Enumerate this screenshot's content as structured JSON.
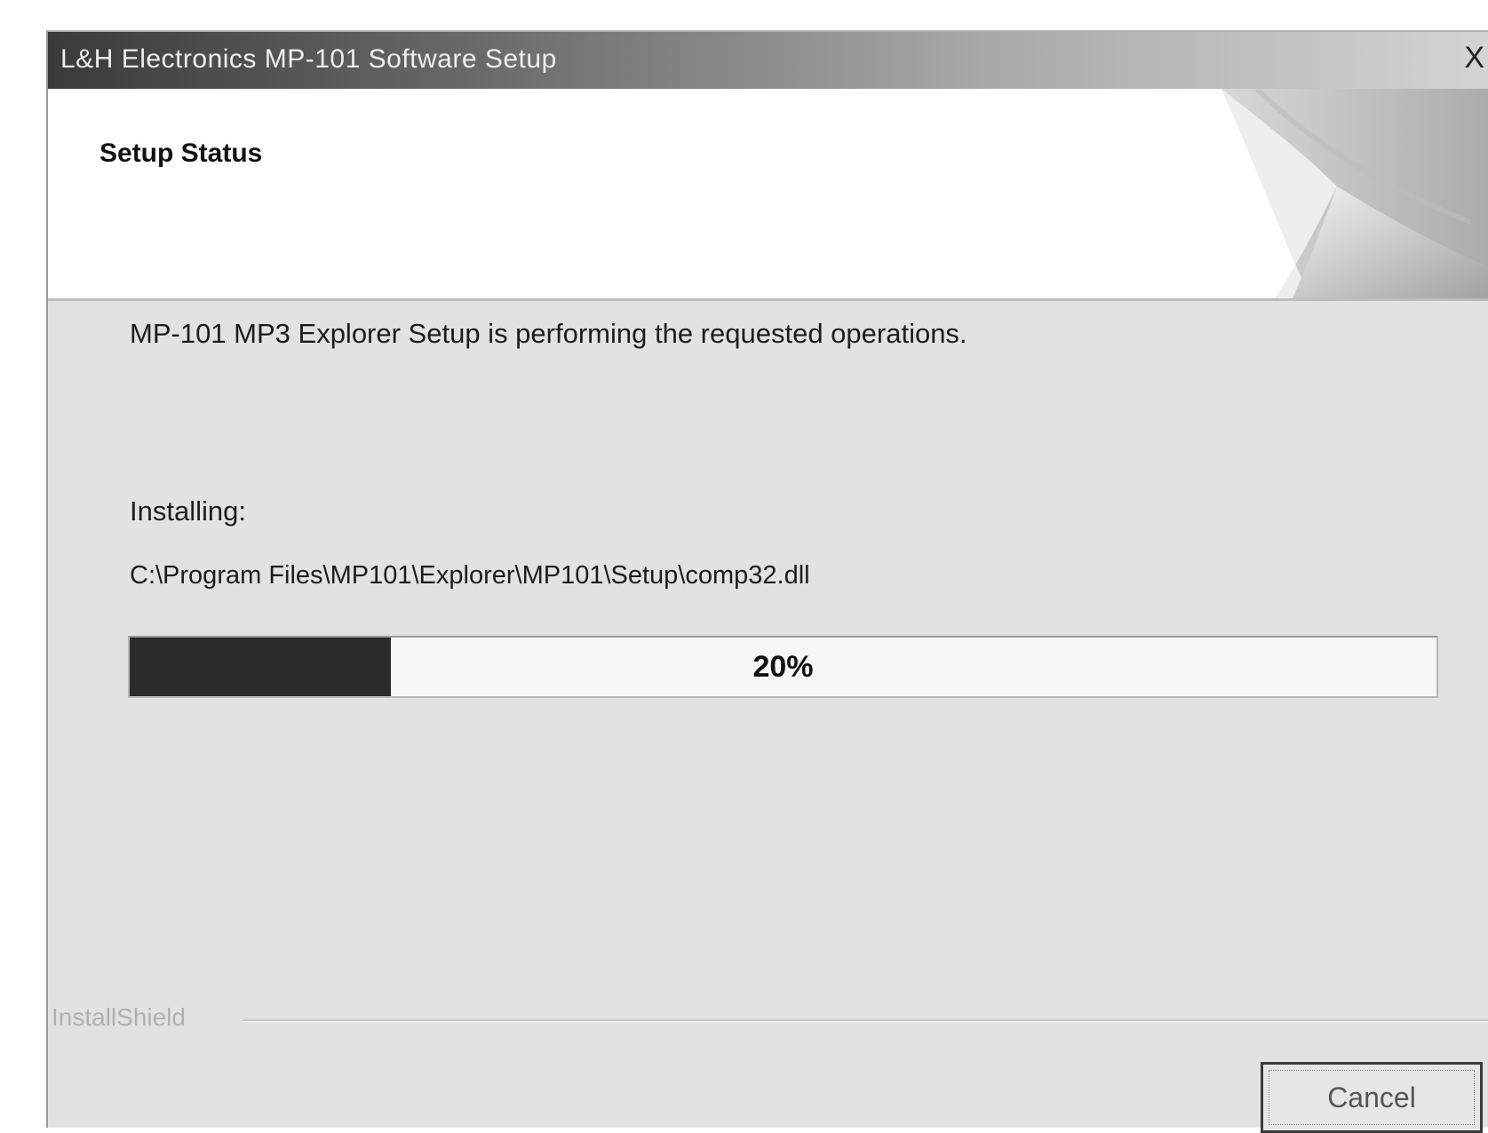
{
  "window": {
    "title": "L&H Electronics MP-101 Software Setup",
    "close_glyph": "X"
  },
  "header": {
    "title": "Setup Status"
  },
  "status": {
    "message": "MP-101 MP3 Explorer Setup is performing the requested operations.",
    "installing_label": "Installing:",
    "file_path": "C:\\Program Files\\MP101\\Explorer\\MP101\\Setup\\comp32.dll"
  },
  "progress": {
    "percent": 20,
    "label": "20%"
  },
  "footer": {
    "brand": "InstallShield",
    "cancel_label": "Cancel"
  },
  "colors": {
    "progress_fill": "#2b2b2b",
    "titlebar_dark": "#3a3a3a",
    "header_bg": "#ffffff",
    "body_bg": "#e2e2e2"
  }
}
